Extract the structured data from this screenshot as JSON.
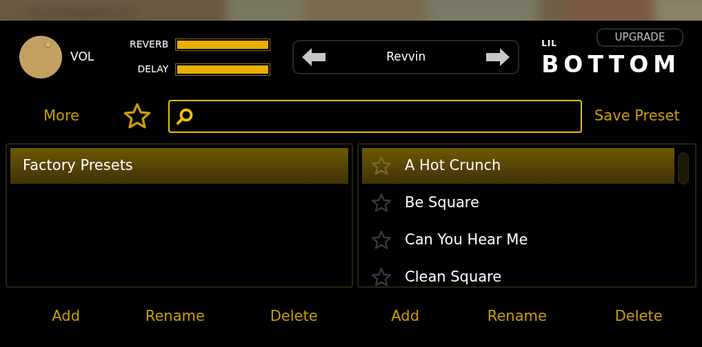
{
  "volume": {
    "label": "VOL"
  },
  "sliders": [
    {
      "label": "REVERB",
      "level": 1.0
    },
    {
      "label": "DELAY",
      "level": 1.0
    }
  ],
  "preset_navigator": {
    "name": "Revvin"
  },
  "logo": {
    "small": "LIL",
    "large": "BOTTOM"
  },
  "upgrade_button": "UPGRADE",
  "more_button": "More",
  "save_button": "Save Preset",
  "banks": {
    "items": [
      {
        "label": "Factory Presets",
        "selected": true
      }
    ],
    "buttons": [
      "Add",
      "Rename",
      "Delete"
    ]
  },
  "presets": {
    "items": [
      {
        "label": "A Hot Crunch",
        "selected": true
      },
      {
        "label": "Be Square",
        "selected": false
      },
      {
        "label": "Can You Hear Me",
        "selected": false
      },
      {
        "label": "Clean Square",
        "selected": false
      }
    ],
    "buttons": [
      "Add",
      "Rename",
      "Delete"
    ]
  }
}
